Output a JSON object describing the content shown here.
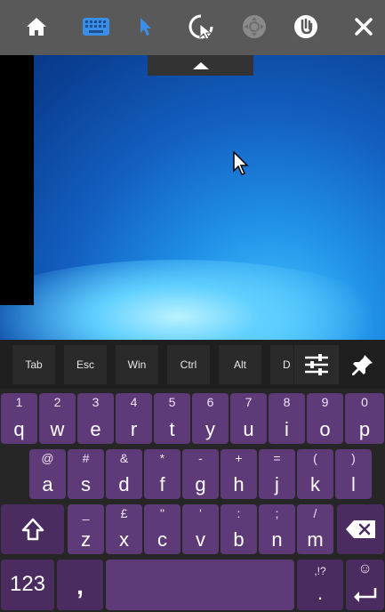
{
  "toolbar": {
    "icons": [
      "home-icon",
      "keyboard-icon",
      "pointer-icon",
      "touch-cursor-icon",
      "dpad-icon",
      "power-icon",
      "close-icon"
    ],
    "colors": {
      "bg": "#595959",
      "active": "#3a8ee6",
      "inactive": "#8a8a8a",
      "white": "#ffffff"
    }
  },
  "modifier_row": [
    "Tab",
    "Esc",
    "Win",
    "Ctrl",
    "Alt",
    "D"
  ],
  "keyboard": {
    "row1": [
      {
        "sub": "1",
        "main": "q"
      },
      {
        "sub": "2",
        "main": "w"
      },
      {
        "sub": "3",
        "main": "e"
      },
      {
        "sub": "4",
        "main": "r"
      },
      {
        "sub": "5",
        "main": "t"
      },
      {
        "sub": "6",
        "main": "y"
      },
      {
        "sub": "7",
        "main": "u"
      },
      {
        "sub": "8",
        "main": "i"
      },
      {
        "sub": "9",
        "main": "o"
      },
      {
        "sub": "0",
        "main": "p"
      }
    ],
    "row2": [
      {
        "sub": "@",
        "main": "a"
      },
      {
        "sub": "#",
        "main": "s"
      },
      {
        "sub": "&",
        "main": "d"
      },
      {
        "sub": "*",
        "main": "f"
      },
      {
        "sub": "-",
        "main": "g"
      },
      {
        "sub": "+",
        "main": "h"
      },
      {
        "sub": "=",
        "main": "j"
      },
      {
        "sub": "(",
        "main": "k"
      },
      {
        "sub": ")",
        "main": "l"
      }
    ],
    "row3": [
      {
        "sub": "_",
        "main": "z"
      },
      {
        "sub": "£",
        "main": "x"
      },
      {
        "sub": "\"",
        "main": "c"
      },
      {
        "sub": "'",
        "main": "v"
      },
      {
        "sub": ":",
        "main": "b"
      },
      {
        "sub": ";",
        "main": "n"
      },
      {
        "sub": "/",
        "main": "m"
      }
    ],
    "numbers_key": "123",
    "comma_key": ",",
    "period_sub": ",!?",
    "period_main": ".",
    "emoji_sub": "☺"
  }
}
